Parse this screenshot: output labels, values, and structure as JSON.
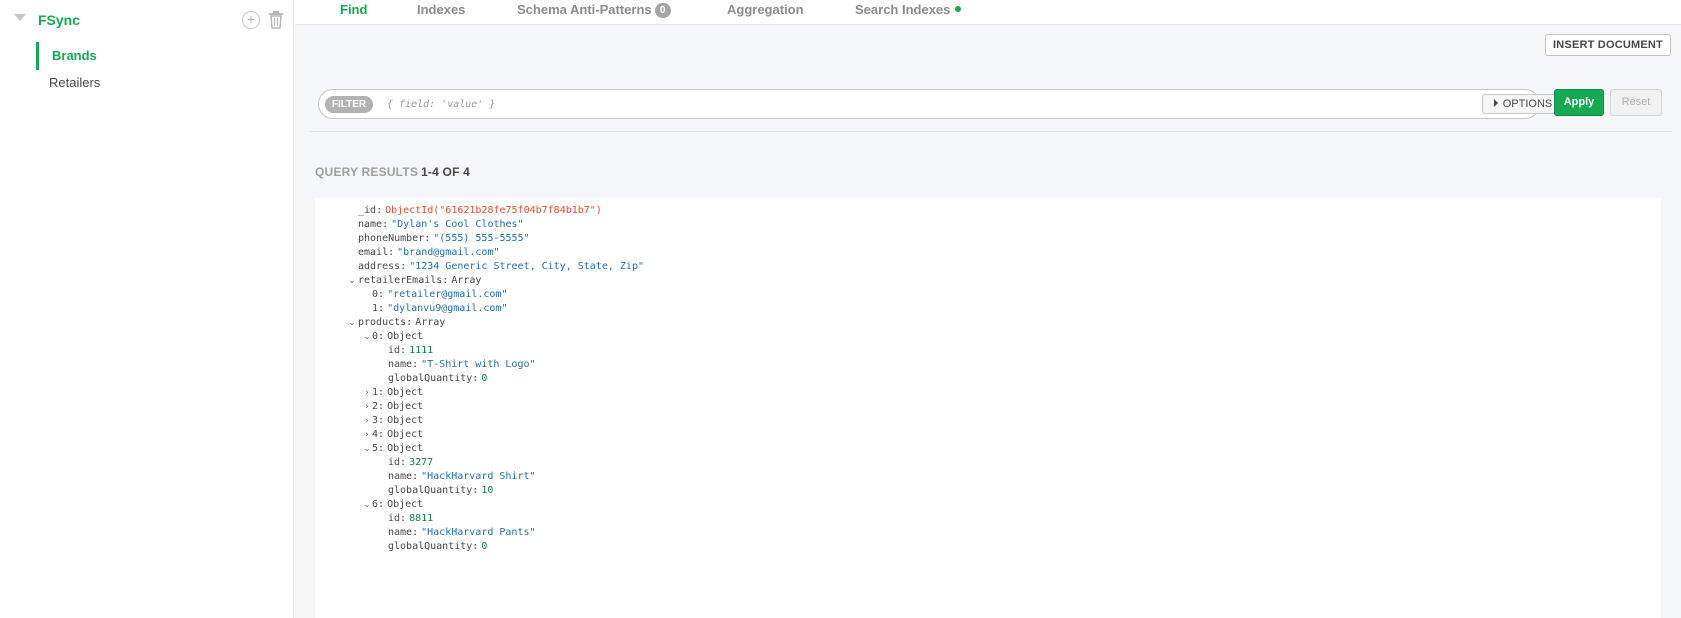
{
  "sidebar": {
    "database": "FSync",
    "collections": [
      {
        "label": "Brands",
        "active": true
      },
      {
        "label": "Retailers",
        "active": false
      }
    ]
  },
  "tabs": [
    {
      "label": "Find",
      "active": true
    },
    {
      "label": "Indexes",
      "active": false
    },
    {
      "label": "Schema Anti-Patterns",
      "active": false,
      "badge": "0"
    },
    {
      "label": "Aggregation",
      "active": false
    },
    {
      "label": "Search Indexes",
      "active": false,
      "status_dot": "#13aa52"
    }
  ],
  "toolbar": {
    "insert_label": "INSERT DOCUMENT"
  },
  "filter": {
    "pill_label": "FILTER",
    "placeholder": "{ field: 'value' }",
    "value": "",
    "options_label": "OPTIONS",
    "apply_label": "Apply",
    "reset_label": "Reset"
  },
  "results": {
    "label": "QUERY RESULTS",
    "count": "1-4 OF 4"
  },
  "document": {
    "id": {
      "key": "_id",
      "value": "ObjectId(\"61621b28fe75f04b7f84b1b7\")"
    },
    "name": {
      "key": "name",
      "value": "\"Dylan's Cool Clothes\""
    },
    "phone": {
      "key": "phoneNumber",
      "value": "\"(555) 555-5555\""
    },
    "email": {
      "key": "email",
      "value": "\"brand@gmail.com\""
    },
    "address": {
      "key": "address",
      "value": "\"1234 Generic Street, City, State, Zip\""
    },
    "retailerEmails": {
      "key": "retailerEmails",
      "type": "Array",
      "items": [
        {
          "key": "0",
          "value": "\"retailer@gmail.com\""
        },
        {
          "key": "1",
          "value": "\"dylanvu9@gmail.com\""
        }
      ]
    },
    "products": {
      "key": "products",
      "type": "Array",
      "p0": {
        "key": "0",
        "type": "Object",
        "id": {
          "key": "id",
          "value": "1111"
        },
        "name": {
          "key": "name",
          "value": "\"T-Shirt with Logo\""
        },
        "qty": {
          "key": "globalQuantity",
          "value": "0"
        }
      },
      "p1": {
        "key": "1",
        "type": "Object"
      },
      "p2": {
        "key": "2",
        "type": "Object"
      },
      "p3": {
        "key": "3",
        "type": "Object"
      },
      "p4": {
        "key": "4",
        "type": "Object"
      },
      "p5": {
        "key": "5",
        "type": "Object",
        "id": {
          "key": "id",
          "value": "3277"
        },
        "name": {
          "key": "name",
          "value": "\"HackHarvard Shirt\""
        },
        "qty": {
          "key": "globalQuantity",
          "value": "10"
        }
      },
      "p6": {
        "key": "6",
        "type": "Object",
        "id": {
          "key": "id",
          "value": "8811"
        },
        "name": {
          "key": "name",
          "value": "\"HackHarvard Pants\""
        },
        "qty": {
          "key": "globalQuantity",
          "value": "0"
        }
      }
    }
  },
  "icons": {
    "expand": "chevron-down-icon",
    "collapse": "chevron-right-icon",
    "add": "plus-circle-icon",
    "delete": "trash-icon"
  },
  "colors": {
    "accent": "#13aa52",
    "object_id": "#e54f2b",
    "string": "#1f6fb2",
    "number": "#14814a"
  }
}
